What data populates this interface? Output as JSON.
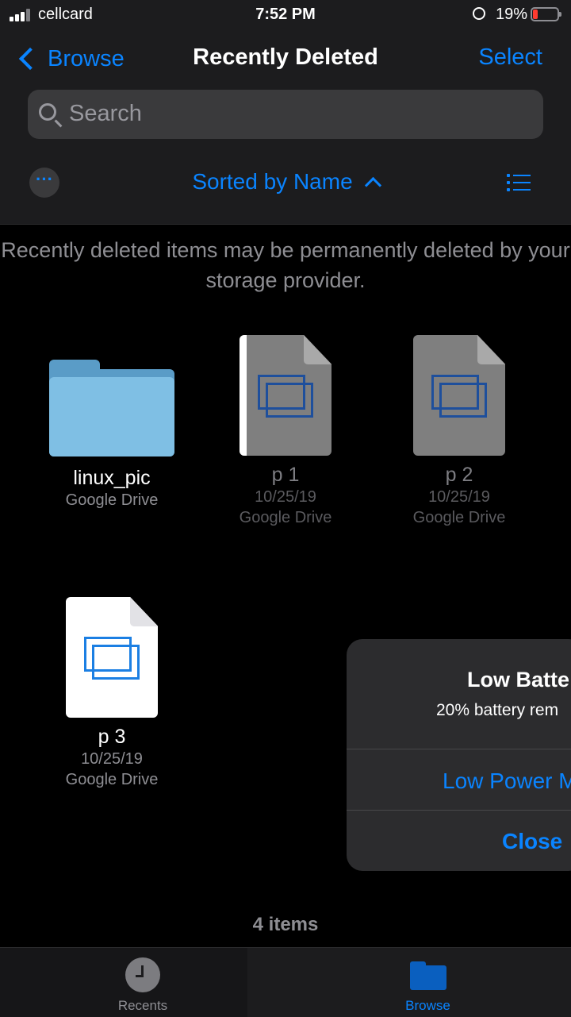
{
  "status_bar": {
    "carrier": "cellcard",
    "time": "7:52 PM",
    "battery_percent": "19%",
    "battery_level": 0.19,
    "battery_color": "#ff3b30"
  },
  "nav": {
    "back_label": "Browse",
    "title": "Recently Deleted",
    "select_label": "Select"
  },
  "search": {
    "placeholder": "Search"
  },
  "toolbar": {
    "sort_label": "Sorted by Name"
  },
  "notice": "Recently deleted items may be permanently deleted by your storage provider.",
  "items": [
    {
      "name": "linux_pic",
      "location": "Google Drive"
    },
    {
      "name": "p 1",
      "date": "10/25/19",
      "location": "Google Drive"
    },
    {
      "name": "p 2",
      "date": "10/25/19",
      "location": "Google Drive"
    },
    {
      "name": "p 3",
      "date": "10/25/19",
      "location": "Google Drive"
    }
  ],
  "item_count": "4 items",
  "alert": {
    "title": "Low Batte",
    "message": "20% battery rem",
    "low_power_button": "Low Power M",
    "close_button": "Close"
  },
  "tabbar": {
    "recents_label": "Recents",
    "browse_label": "Browse"
  },
  "colors": {
    "accent": "#0a84ff",
    "background": "#000000",
    "folder": "#7fbfe4"
  }
}
